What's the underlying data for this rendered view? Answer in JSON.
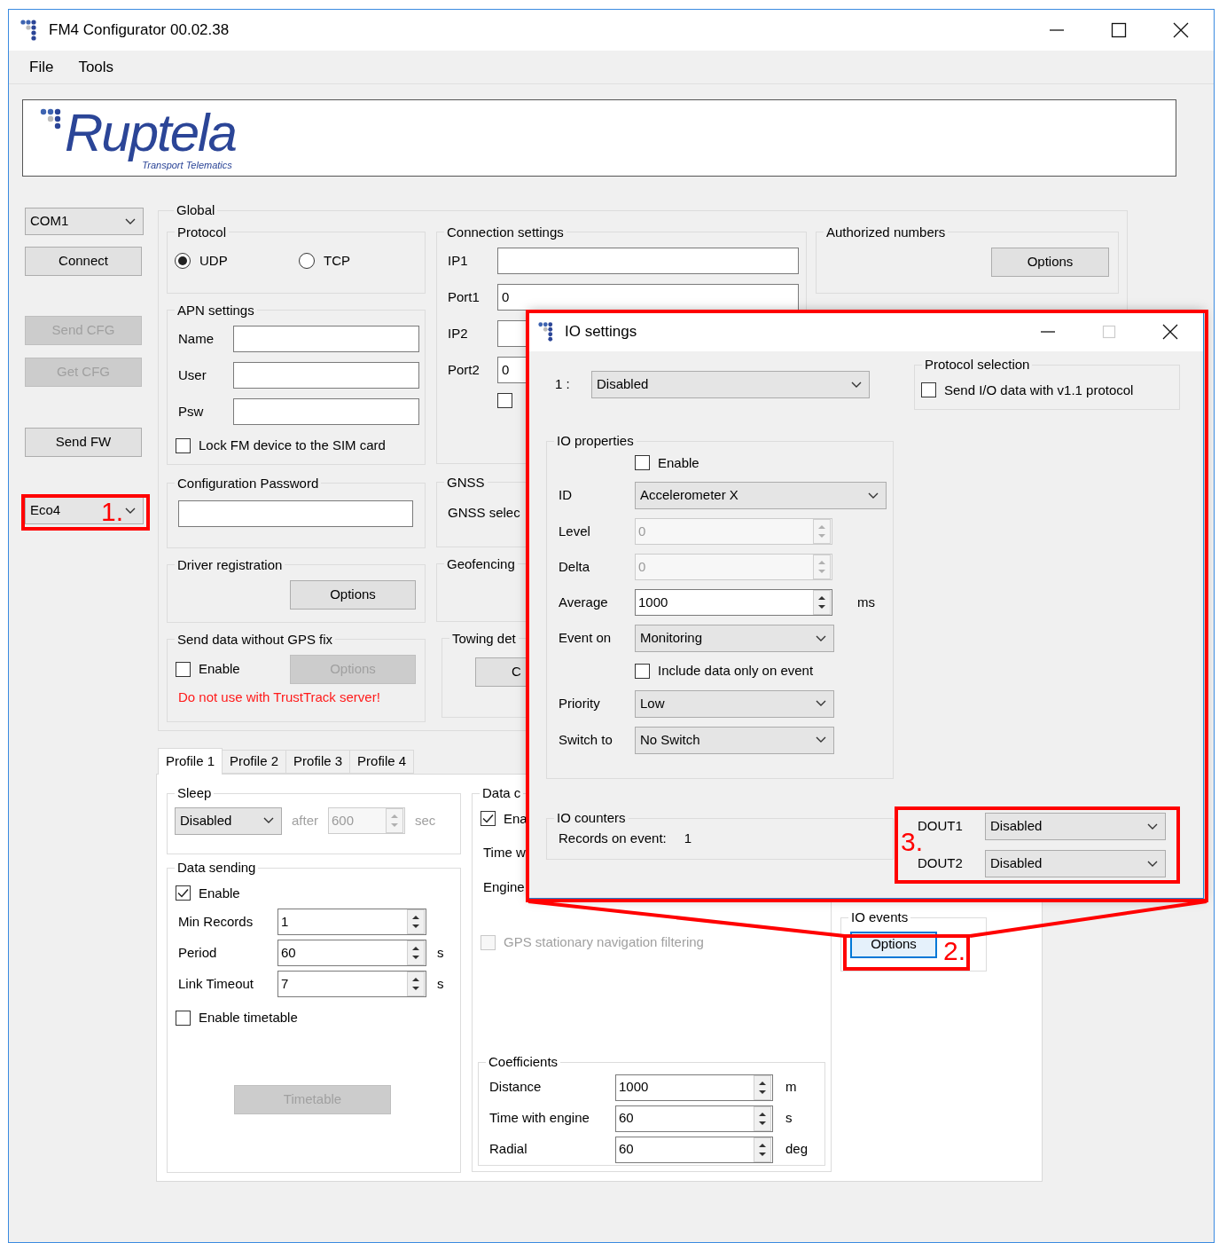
{
  "window": {
    "title": "FM4 Configurator 00.02.38"
  },
  "menu": [
    "File",
    "Tools"
  ],
  "logo": {
    "wordmark": "Ruptela",
    "tagline": "Transport Telematics"
  },
  "sidebar": {
    "port": "COM1",
    "buttons": [
      {
        "label": "Connect",
        "disabled": false
      },
      {
        "label": "Send CFG",
        "disabled": true
      },
      {
        "label": "Get CFG",
        "disabled": true
      },
      {
        "label": "Send FW",
        "disabled": false
      }
    ],
    "device": "Eco4"
  },
  "global": {
    "title": "Global",
    "protocol": {
      "title": "Protocol",
      "options": [
        {
          "label": "UDP",
          "selected": true
        },
        {
          "label": "TCP",
          "selected": false
        }
      ]
    },
    "apn": {
      "title": "APN settings",
      "fields": [
        {
          "label": "Name"
        },
        {
          "label": "User"
        },
        {
          "label": "Psw"
        }
      ],
      "lock": {
        "label": "Lock FM device to the SIM card",
        "checked": false
      }
    },
    "config_password": {
      "title": "Configuration Password"
    },
    "driver_registration": {
      "title": "Driver registration",
      "button": {
        "label": "Options",
        "disabled": false
      }
    },
    "no_gps_fix": {
      "title": "Send data without GPS fix",
      "enable": {
        "label": "Enable",
        "checked": false
      },
      "button": {
        "label": "Options",
        "disabled": true
      },
      "warning": "Do not use with TrustTrack server!"
    },
    "connection": {
      "title": "Connection settings",
      "fields": [
        {
          "label": "IP1"
        },
        {
          "label": "Port1",
          "value": "0"
        },
        {
          "label": "IP2"
        },
        {
          "label": "Port2",
          "value": "0"
        }
      ],
      "checkbox": {
        "checked": false
      }
    },
    "gnss": {
      "title": "GNSS",
      "label": "GNSS selec"
    },
    "geofencing": {
      "title": "Geofencing"
    },
    "towing": {
      "title": "Towing det",
      "button": {
        "label": "C",
        "disabled": false
      }
    },
    "authorized_numbers": {
      "title": "Authorized numbers",
      "button": {
        "label": "Options",
        "disabled": false
      }
    }
  },
  "profile_tabs": [
    {
      "label": "Profile 1",
      "selected": true
    },
    {
      "label": "Profile 2",
      "selected": false
    },
    {
      "label": "Profile 3",
      "selected": false
    },
    {
      "label": "Profile 4",
      "selected": false
    }
  ],
  "sleep": {
    "title": "Sleep",
    "mode": "Disabled",
    "after": "after",
    "value": "600",
    "unit": "sec",
    "disabled": true
  },
  "data_sending": {
    "title": "Data sending",
    "enable": {
      "label": "Enable",
      "checked": true
    },
    "fields": [
      {
        "label": "Min Records",
        "value": "1"
      },
      {
        "label": "Period",
        "value": "60",
        "unit": "s"
      },
      {
        "label": "Link Timeout",
        "value": "7",
        "unit": "s"
      }
    ],
    "timetable": {
      "label": "Enable timetable",
      "checked": false
    },
    "button": {
      "label": "Timetable",
      "disabled": true
    }
  },
  "data_group": {
    "title": "Data c",
    "enable": {
      "label": "Ena",
      "checked": true
    },
    "labels": [
      "Time w",
      "Engine"
    ],
    "gps_filter": {
      "label": "GPS stationary navigation filtering",
      "checked": false,
      "disabled": true
    },
    "coefficients": {
      "title": "Coefficients",
      "fields": [
        {
          "label": "Distance",
          "value": "1000",
          "unit": "m"
        },
        {
          "label": "Time with engine",
          "value": "60",
          "unit": "s"
        },
        {
          "label": "Radial",
          "value": "60",
          "unit": "deg"
        }
      ]
    }
  },
  "io_events": {
    "title": "IO events",
    "button": {
      "label": "Options",
      "disabled": false
    }
  },
  "io_dialog": {
    "title": "IO settings",
    "io_index": "1 :",
    "io_select": "Disabled",
    "protocol_selection": {
      "title": "Protocol selection",
      "checkbox": {
        "label": "Send I/O data with v1.1 protocol",
        "checked": false
      }
    },
    "io_properties": {
      "title": "IO properties",
      "enable": {
        "label": "Enable",
        "checked": false
      },
      "rows": [
        {
          "kind": "dropdown",
          "label": "ID",
          "value": "Accelerometer X"
        },
        {
          "kind": "spinner",
          "label": "Level",
          "value": "0",
          "disabled": true
        },
        {
          "kind": "spinner",
          "label": "Delta",
          "value": "0",
          "disabled": true
        },
        {
          "kind": "spinner",
          "label": "Average",
          "value": "1000",
          "disabled": false,
          "unit": "ms"
        },
        {
          "kind": "dropdown",
          "label": "Event on",
          "value": "Monitoring"
        },
        {
          "kind": "checkbox",
          "label": "Include data only on event",
          "checked": false
        },
        {
          "kind": "dropdown",
          "label": "Priority",
          "value": "Low"
        },
        {
          "kind": "dropdown",
          "label": "Switch to",
          "value": "No Switch"
        }
      ]
    },
    "io_counters": {
      "title": "IO counters",
      "label": "Records on event:",
      "value": "1"
    },
    "outputs": [
      {
        "label": "DOUT1",
        "value": "Disabled"
      },
      {
        "label": "DOUT2",
        "value": "Disabled"
      }
    ]
  },
  "annotations": [
    {
      "label": "1."
    },
    {
      "label": "2."
    },
    {
      "label": "3."
    }
  ]
}
